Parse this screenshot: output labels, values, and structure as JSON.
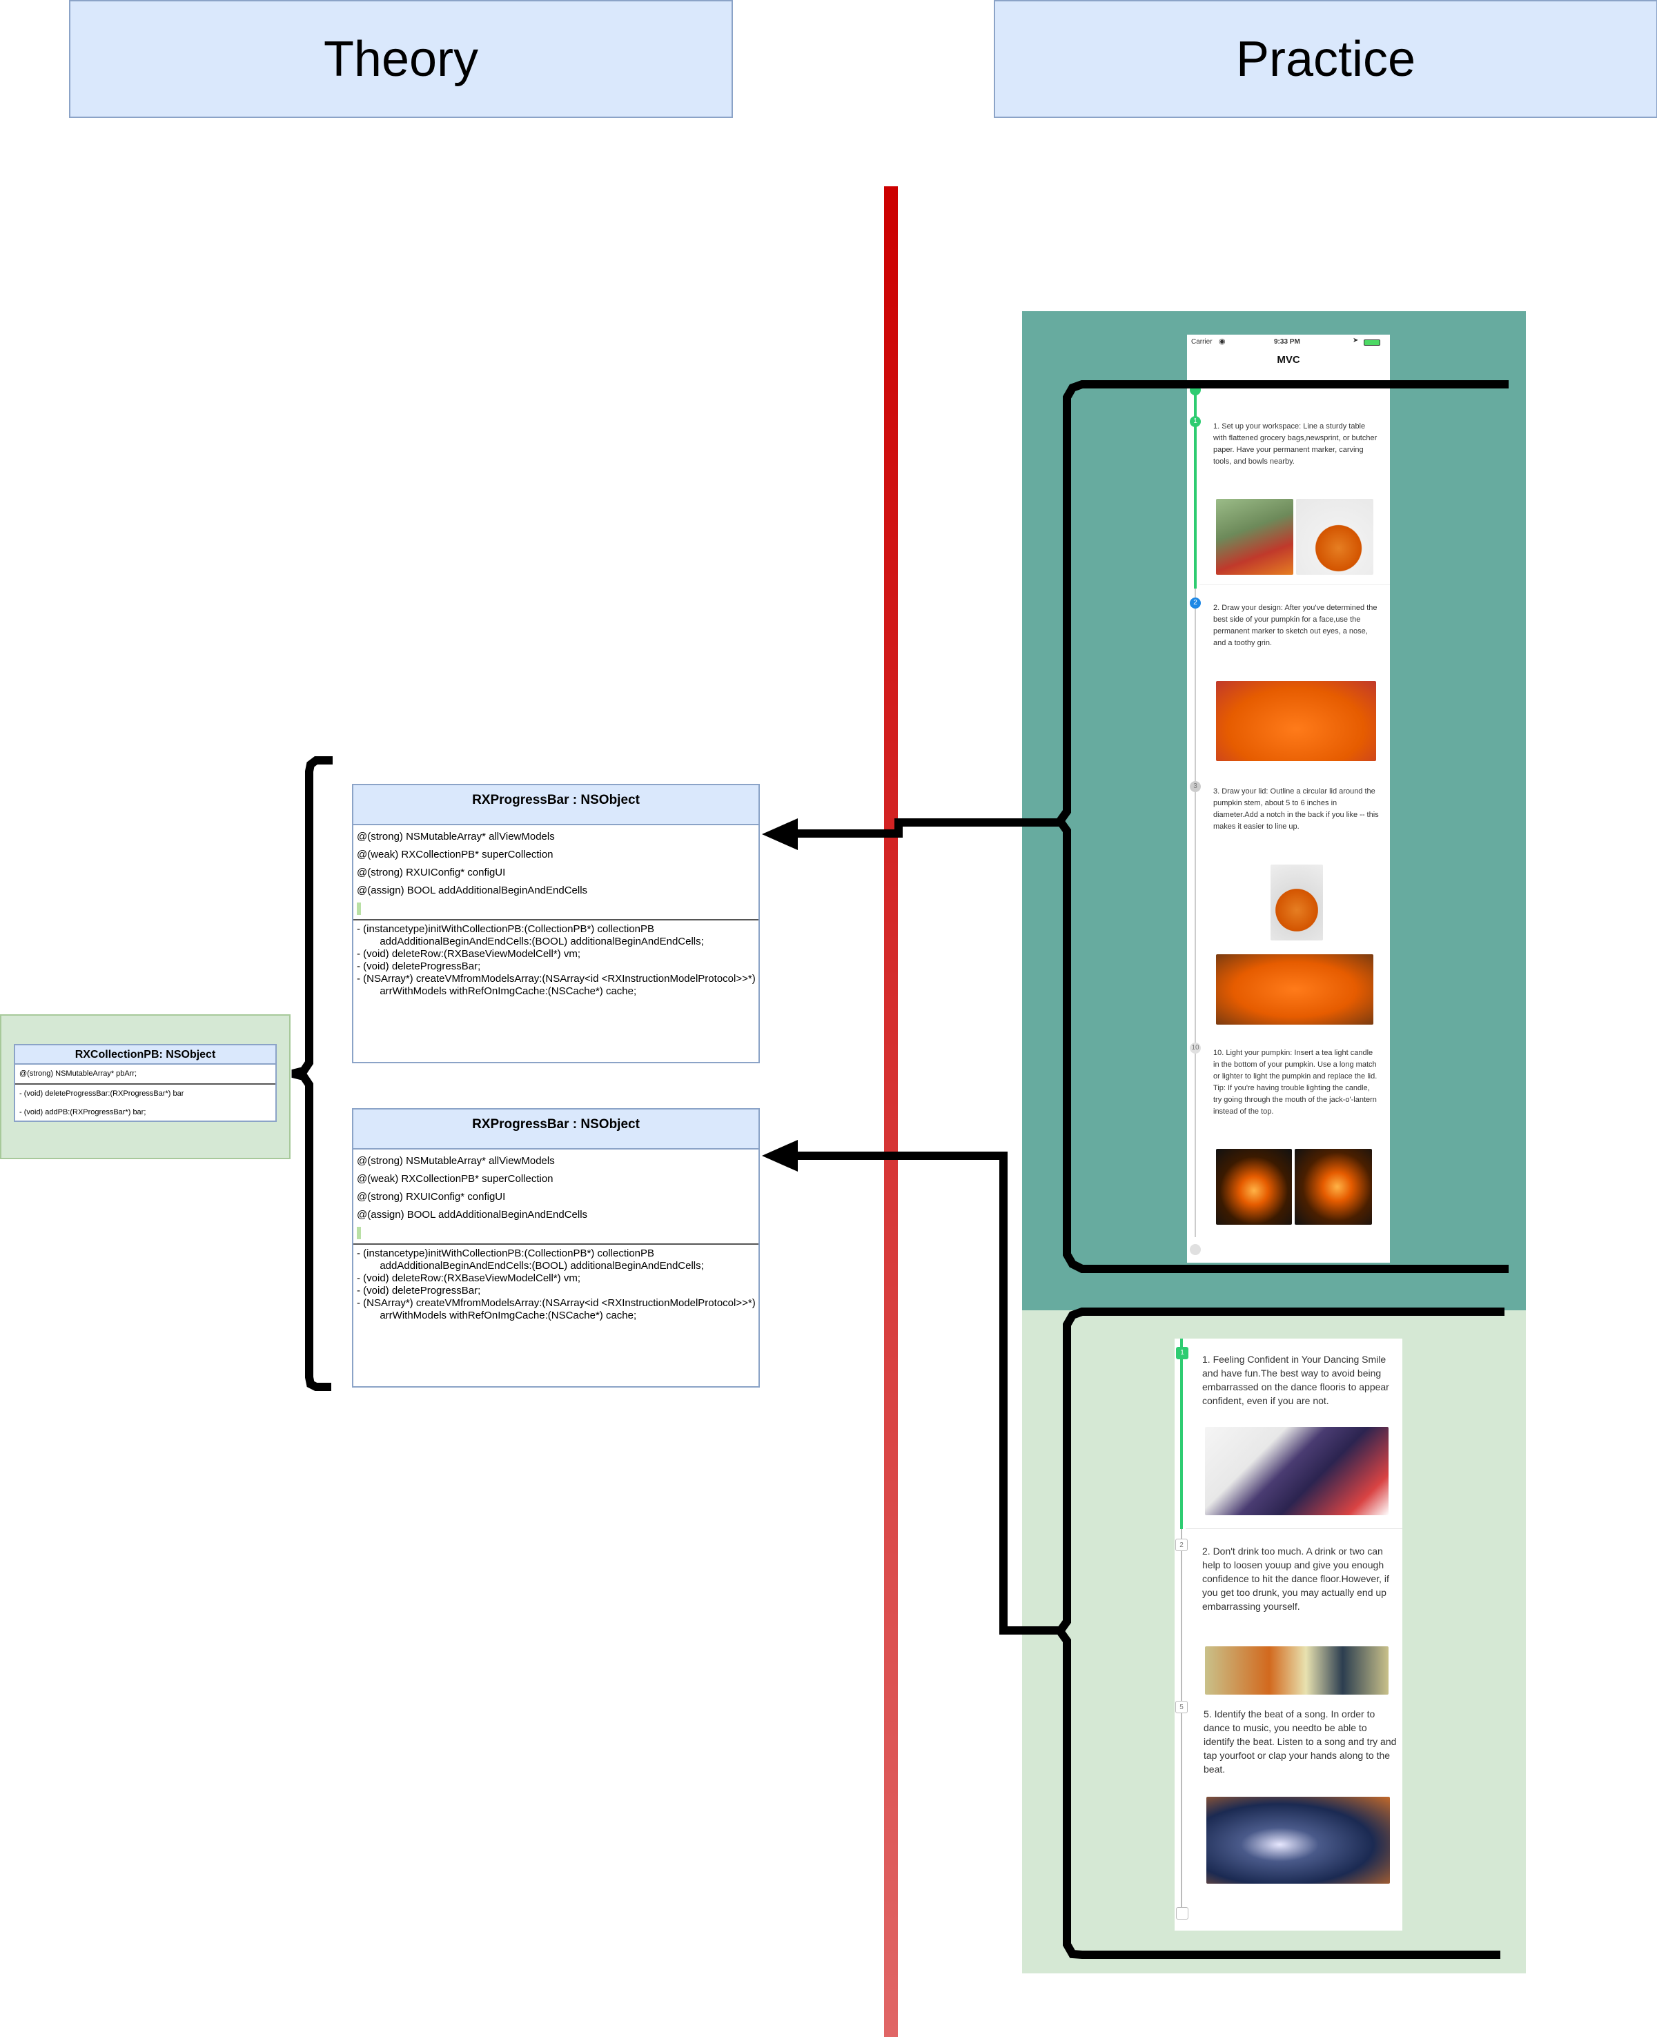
{
  "headers": {
    "theory": "Theory",
    "practice": "Practice"
  },
  "collection_pb": {
    "title": "RXCollectionPB: NSObject",
    "attributes": [
      "@(strong) NSMutableArray* pbArr;"
    ],
    "methods": [
      "- (void) deleteProgressBar:(RXProgressBar*) bar",
      "- (void) addPB:(RXProgressBar*) bar;"
    ]
  },
  "progress_bar": {
    "title": "RXProgressBar : NSObject",
    "attributes": [
      "@(strong) NSMutableArray* allViewModels",
      "@(weak) RXCollectionPB* superCollection",
      "@(strong) RXUIConfig* configUI",
      "@(assign) BOOL addAdditionalBeginAndEndCells"
    ],
    "methods": [
      "- (instancetype)initWithCollectionPB:(CollectionPB*) collectionPB",
      "        addAdditionalBeginAndEndCells:(BOOL) additionalBeginAndEndCells;",
      "",
      "- (void) deleteRow:(RXBaseViewModelCell*) vm;",
      "",
      "- (void) deleteProgressBar;",
      "",
      "- (NSArray*) createVMfromModelsArray:(NSArray<id <RXInstructionModelProtocol>>*)",
      "        arrWithModels withRefOnImgCache:(NSCache*) cache;"
    ]
  },
  "phone_top": {
    "carrier": "Carrier",
    "time": "9:33 PM",
    "nav_title": "MVC",
    "steps": [
      {
        "num": "1",
        "text": "1. Set up your workspace: Line a sturdy table with flattened grocery bags,newsprint, or butcher paper. Have your permanent marker, carving tools, and bowls nearby."
      },
      {
        "num": "2",
        "text": "2. Draw your design: After you've determined the best side of your pumpkin for a face,use the permanent marker to sketch out eyes, a nose, and a toothy grin."
      },
      {
        "num": "3",
        "text": "3. Draw your lid: Outline a circular lid around the pumpkin stem, about 5 to 6 inches in diameter.Add a notch in the back if you like -- this makes it easier to line up."
      },
      {
        "num": "10",
        "text": "10. Light your pumpkin: Insert a tea light candle in the bottom of your pumpkin. Use a long match or lighter to light the pumpkin and replace the lid. Tip: If you're having trouble lighting the candle, try going through the mouth of the jack-o'-lantern instead of the top."
      }
    ]
  },
  "phone_bottom": {
    "steps": [
      {
        "num": "1",
        "text": "1. Feeling Confident in Your Dancing Smile and have fun.The best way to avoid being embarrassed on the dance flooris to appear confident, even if you are not."
      },
      {
        "num": "2",
        "text": "2. Don't drink too much. A drink or two can help to loosen youup and give you enough confidence to hit the dance floor.However, if you get too drunk, you may actually end up embarrassing yourself."
      },
      {
        "num": "5",
        "text": "5.  Identify the beat of a song. In order to dance to music, you needto be able to identify the beat. Listen to a song and try and tap yourfoot or clap your hands along to the beat."
      }
    ]
  },
  "colors": {
    "header_fill": "#dae8fc",
    "divider": "#cc0000",
    "top_panel": "#67ab9f",
    "bottom_panel": "#d5e8d4",
    "progress_green": "#2ecc71",
    "progress_blue": "#1e88e5"
  }
}
